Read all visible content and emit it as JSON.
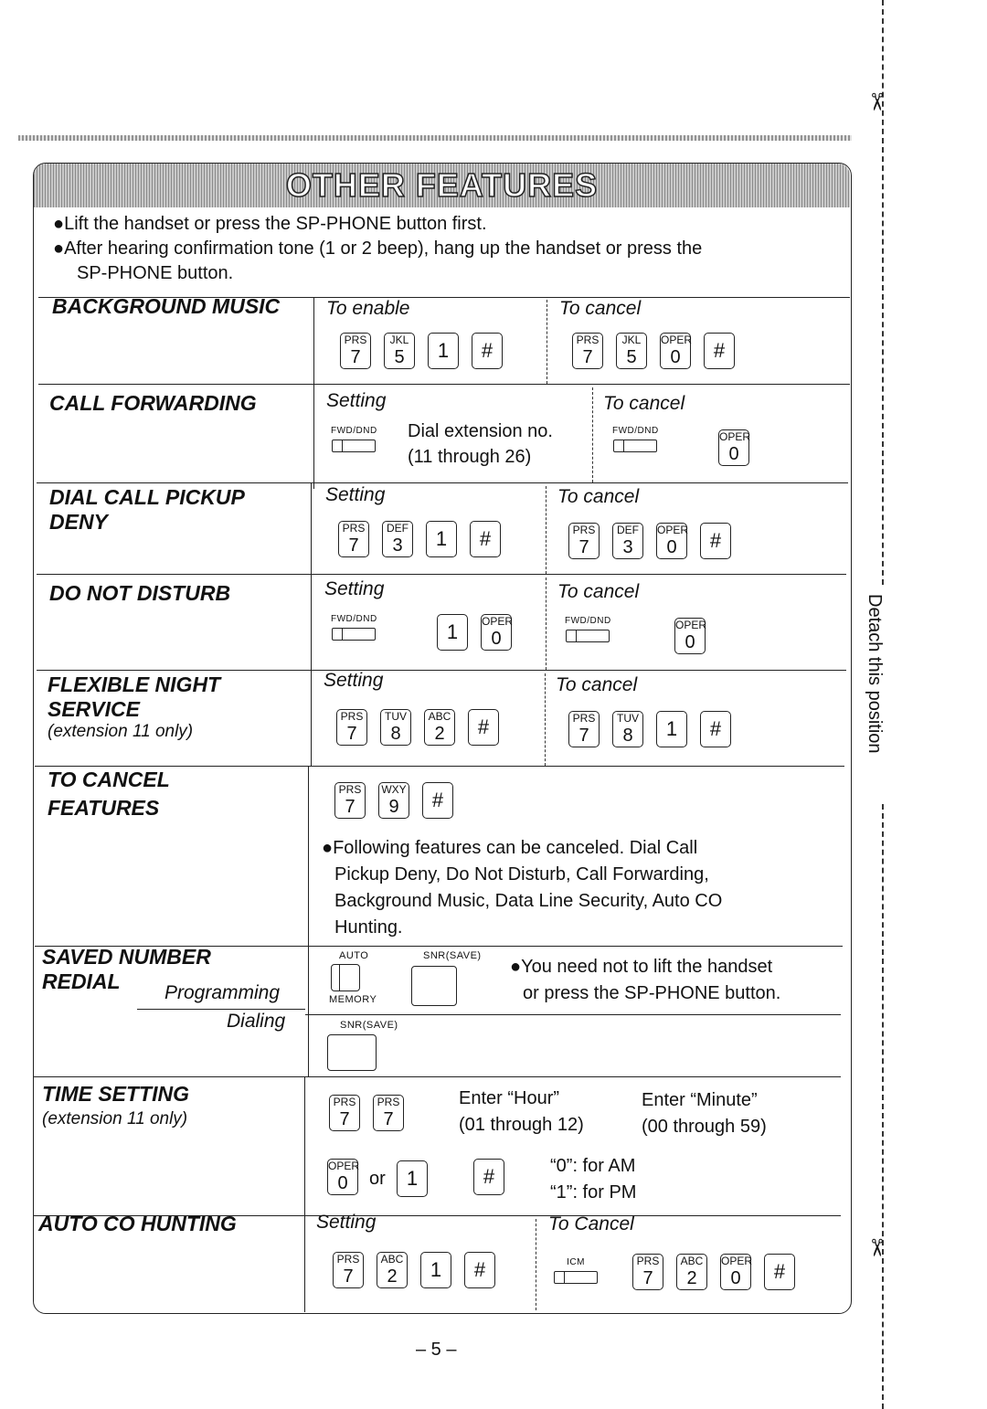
{
  "title": "OTHER FEATURES",
  "intro": [
    "●Lift the handset or press the SP-PHONE button first.",
    "●After hearing confirmation tone (1 or 2 beep), hang up the handset or press the",
    "SP-PHONE button."
  ],
  "background_music": {
    "label": "BACKGROUND MUSIC",
    "enable_caption": "To enable",
    "cancel_caption": "To cancel",
    "enable_keys": [
      {
        "t": "PRS",
        "n": "7"
      },
      {
        "t": "JKL",
        "n": "5"
      },
      {
        "t": "",
        "n": "1"
      },
      {
        "t": "",
        "n": "#"
      }
    ],
    "cancel_keys": [
      {
        "t": "PRS",
        "n": "7"
      },
      {
        "t": "JKL",
        "n": "5"
      },
      {
        "t": "OPER",
        "n": "0"
      },
      {
        "t": "",
        "n": "#"
      }
    ]
  },
  "call_forwarding": {
    "label": "CALL FORWARDING",
    "setting_caption": "Setting",
    "cancel_caption": "To cancel",
    "button_label": "FWD/DND",
    "dial_text": "Dial extension no.",
    "range_text": "(11 through 26)",
    "cancel_keys": [
      {
        "t": "OPER",
        "n": "0"
      }
    ]
  },
  "dial_call_pickup_deny": {
    "label": [
      "DIAL CALL PICKUP",
      "DENY"
    ],
    "setting_caption": "Setting",
    "cancel_caption": "To cancel",
    "setting_keys": [
      {
        "t": "PRS",
        "n": "7"
      },
      {
        "t": "DEF",
        "n": "3"
      },
      {
        "t": "",
        "n": "1"
      },
      {
        "t": "",
        "n": "#"
      }
    ],
    "cancel_keys": [
      {
        "t": "PRS",
        "n": "7"
      },
      {
        "t": "DEF",
        "n": "3"
      },
      {
        "t": "OPER",
        "n": "0"
      },
      {
        "t": "",
        "n": "#"
      }
    ]
  },
  "do_not_disturb": {
    "label": "DO NOT DISTURB",
    "setting_caption": "Setting",
    "cancel_caption": "To cancel",
    "button_label": "FWD/DND",
    "setting_keys": [
      {
        "t": "",
        "n": "1"
      },
      {
        "t": "OPER",
        "n": "0"
      }
    ],
    "cancel_keys": [
      {
        "t": "OPER",
        "n": "0"
      }
    ]
  },
  "flexible_night_service": {
    "label": [
      "FLEXIBLE NIGHT",
      "SERVICE"
    ],
    "note": "(extension 11 only)",
    "setting_caption": "Setting",
    "cancel_caption": "To cancel",
    "setting_keys": [
      {
        "t": "PRS",
        "n": "7"
      },
      {
        "t": "TUV",
        "n": "8"
      },
      {
        "t": "ABC",
        "n": "2"
      },
      {
        "t": "",
        "n": "#"
      }
    ],
    "cancel_keys": [
      {
        "t": "PRS",
        "n": "7"
      },
      {
        "t": "TUV",
        "n": "8"
      },
      {
        "t": "",
        "n": "1"
      },
      {
        "t": "",
        "n": "#"
      }
    ]
  },
  "to_cancel_features": {
    "label": [
      "TO CANCEL",
      "FEATURES"
    ],
    "keys": [
      {
        "t": "PRS",
        "n": "7"
      },
      {
        "t": "WXY",
        "n": "9"
      },
      {
        "t": "",
        "n": "#"
      }
    ],
    "note": [
      "●Following features can be canceled. Dial Call",
      "Pickup Deny, Do Not Disturb, Call Forwarding,",
      "Background Music, Data Line Security, Auto CO",
      "Hunting."
    ]
  },
  "saved_number_redial": {
    "label": [
      "SAVED NUMBER",
      "REDIAL"
    ],
    "programming": "Programming",
    "dialing": "Dialing",
    "auto_label": "AUTO",
    "memory_label": "MEMORY",
    "snr_label": "SNR(SAVE)",
    "note": [
      "●You need not to lift the handset",
      "or press the SP-PHONE button."
    ]
  },
  "time_setting": {
    "label": "TIME SETTING",
    "note": "(extension 11 only)",
    "keys": [
      {
        "t": "PRS",
        "n": "7"
      },
      {
        "t": "PRS",
        "n": "7"
      }
    ],
    "hour": [
      "Enter “Hour”",
      "(01 through 12)"
    ],
    "minute": [
      "Enter “Minute”",
      "(00 through 59)"
    ],
    "ampm_keys_a": [
      {
        "t": "OPER",
        "n": "0"
      }
    ],
    "or": "or",
    "ampm_keys_b": [
      {
        "t": "",
        "n": "1"
      }
    ],
    "hash_keys": [
      {
        "t": "",
        "n": "#"
      }
    ],
    "am": "“0”:  for AM",
    "pm": "“1”:  for PM"
  },
  "auto_co_hunting": {
    "label": "AUTO CO HUNTING",
    "setting_caption": "Setting",
    "cancel_caption": "To Cancel",
    "icm_label": "ICM",
    "setting_keys": [
      {
        "t": "PRS",
        "n": "7"
      },
      {
        "t": "ABC",
        "n": "2"
      },
      {
        "t": "",
        "n": "1"
      },
      {
        "t": "",
        "n": "#"
      }
    ],
    "cancel_keys": [
      {
        "t": "PRS",
        "n": "7"
      },
      {
        "t": "ABC",
        "n": "2"
      },
      {
        "t": "OPER",
        "n": "0"
      },
      {
        "t": "",
        "n": "#"
      }
    ]
  },
  "side_text": "Detach this position",
  "page_number": "– 5 –"
}
